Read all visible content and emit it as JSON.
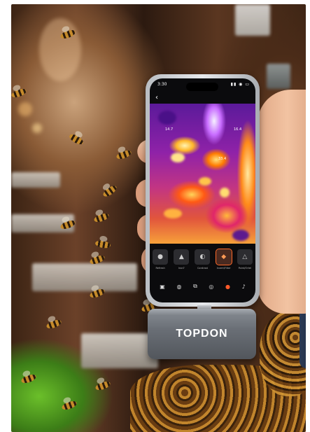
{
  "phone": {
    "status_time": "3:30",
    "status_right": "▮▮ ◉ ▭",
    "back": "‹",
    "readouts": [
      "14.7",
      "16.4",
      "33.4"
    ],
    "modes": [
      {
        "label": "Refresh",
        "icon": "●"
      },
      {
        "label": "Iron?",
        "icon": "▲"
      },
      {
        "label": "Contrast",
        "icon": "◐"
      },
      {
        "label": "Invert/Filter",
        "icon": "◆"
      },
      {
        "label": "Point/Ortel",
        "icon": "△"
      }
    ],
    "tools": [
      "▣",
      "◍",
      "⧉",
      "◎",
      "●",
      "♪"
    ]
  },
  "device": {
    "brand": "TOPDON"
  }
}
